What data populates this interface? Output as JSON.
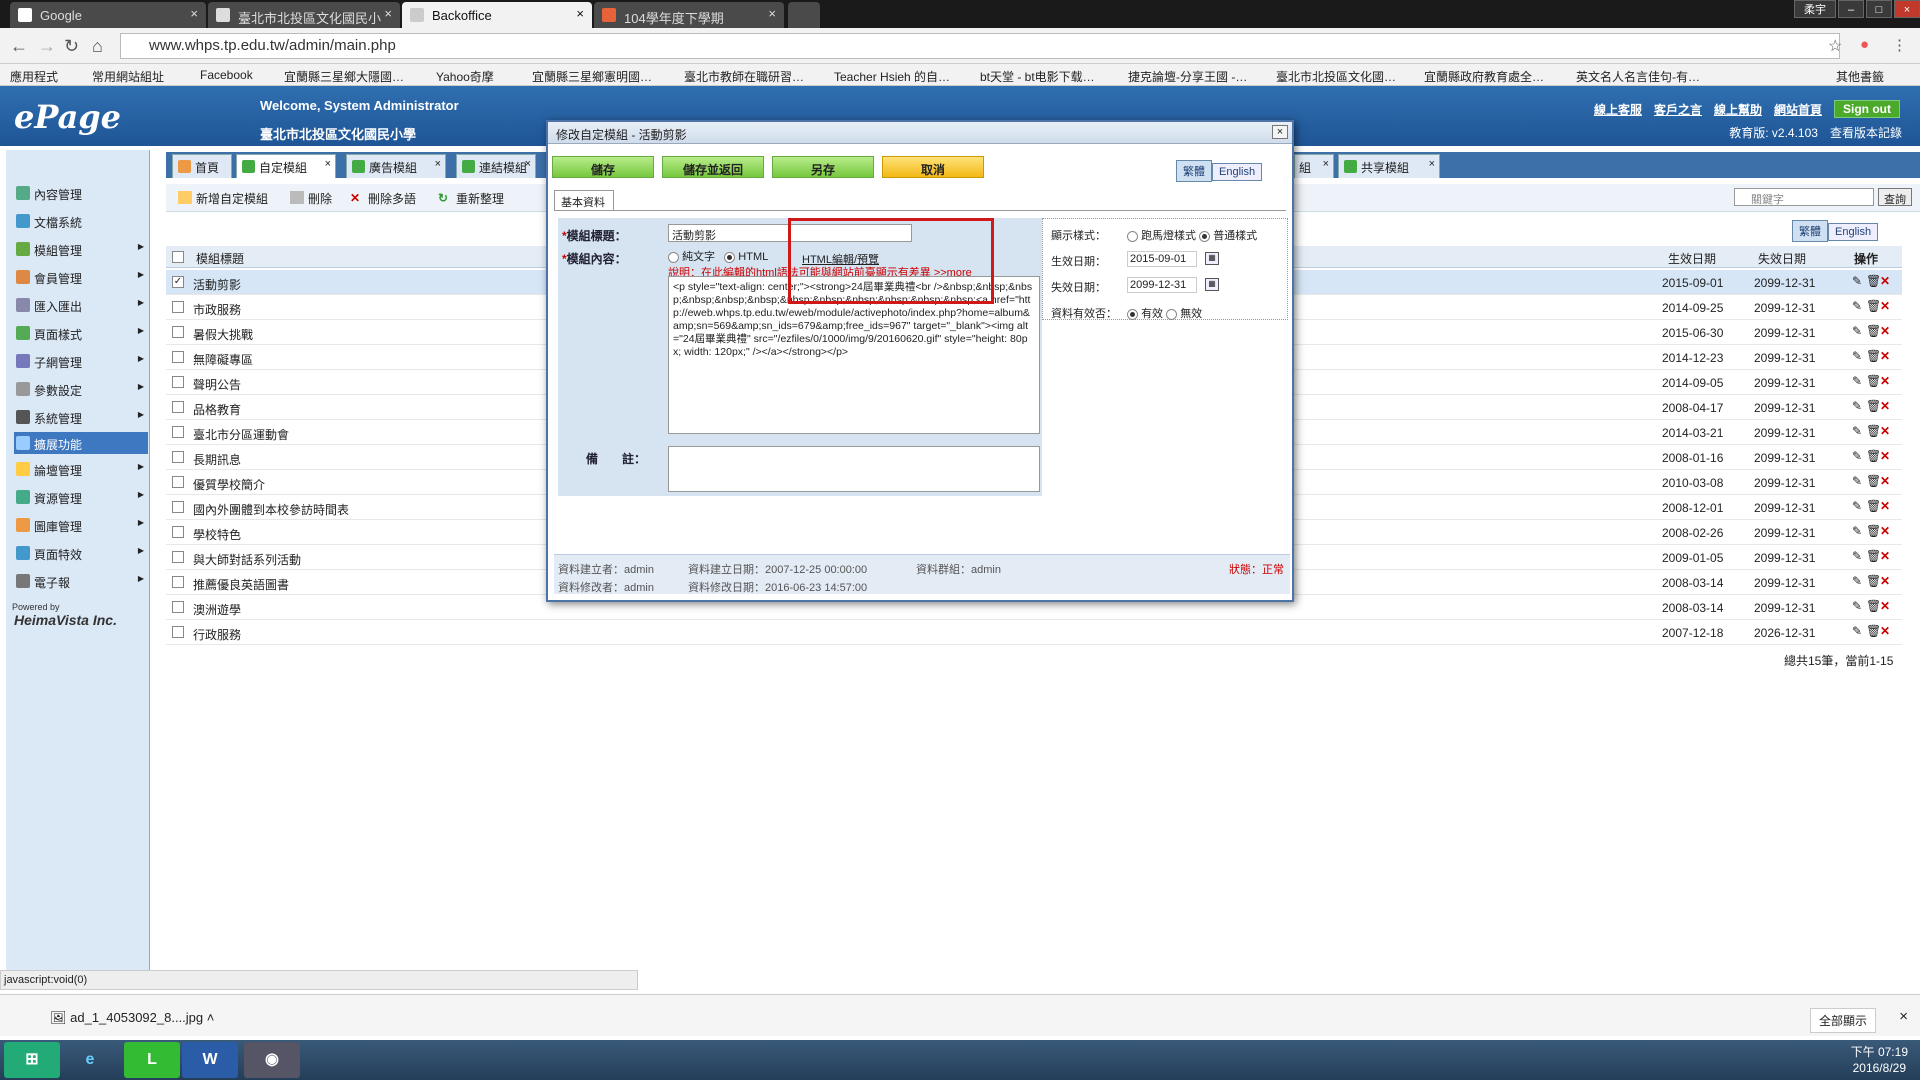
{
  "browser": {
    "tabs": [
      {
        "label": "Google",
        "color": "#ffffff"
      },
      {
        "label": "臺北市北投區文化國民小",
        "color": "#ffffff"
      },
      {
        "label": "Backoffice",
        "color": "#ffffff"
      },
      {
        "label": "104學年度下學期",
        "color": "#e8623a"
      }
    ],
    "user": "柔宇",
    "url": "www.whps.tp.edu.tw/admin/main.php",
    "bookmarks": [
      "應用程式",
      "常用網站組址",
      "Facebook",
      "宜蘭縣三星鄉大隱國…",
      "Yahoo奇摩",
      "宜蘭縣三星鄉憲明國…",
      "臺北市教師在職研習…",
      "Teacher Hsieh 的自…",
      "bt天堂 - bt电影下载…",
      "捷克論壇-分享王國 -…",
      "臺北市北投區文化國…",
      "宜蘭縣政府教育處全…",
      "英文名人名言佳句-有…",
      "其他書籤"
    ]
  },
  "header": {
    "logo": "ePage",
    "welcome": "Welcome, System Administrator",
    "school": "臺北市北投區文化國民小學",
    "links": [
      "線上客服",
      "客戶之言",
      "線上幫助",
      "網站首頁"
    ],
    "signout": "Sign out",
    "version": "教育版: v2.4.103",
    "history": "查看版本記錄"
  },
  "sidebar": {
    "items": [
      {
        "label": "內容管理",
        "arrow": false,
        "selected": false
      },
      {
        "label": "文檔系統",
        "arrow": false,
        "selected": false
      },
      {
        "label": "模組管理",
        "arrow": true,
        "selected": false
      },
      {
        "label": "會員管理",
        "arrow": true,
        "selected": false
      },
      {
        "label": "匯入匯出",
        "arrow": true,
        "selected": false
      },
      {
        "label": "頁面樣式",
        "arrow": true,
        "selected": false
      },
      {
        "label": "子網管理",
        "arrow": true,
        "selected": false
      },
      {
        "label": "參數設定",
        "arrow": true,
        "selected": false
      },
      {
        "label": "系統管理",
        "arrow": true,
        "selected": false
      },
      {
        "label": "擴展功能",
        "arrow": false,
        "selected": true
      },
      {
        "label": "論壇管理",
        "arrow": true,
        "selected": false
      },
      {
        "label": "資源管理",
        "arrow": true,
        "selected": false
      },
      {
        "label": "圖庫管理",
        "arrow": true,
        "selected": false
      },
      {
        "label": "頁面特效",
        "arrow": true,
        "selected": false
      },
      {
        "label": "電子報",
        "arrow": true,
        "selected": false
      }
    ],
    "powered_by": "Powered by",
    "brand": "HeimaVista Inc."
  },
  "main": {
    "tabs": [
      {
        "label": "首頁",
        "closable": false
      },
      {
        "label": "自定模組",
        "closable": true
      },
      {
        "label": "廣告模組",
        "closable": true
      },
      {
        "label": "連結模組",
        "closable": true
      },
      {
        "label": "組",
        "closable": true
      },
      {
        "label": "共享模組",
        "closable": true
      }
    ],
    "toolbar": [
      "新增自定模組",
      "刪除",
      "刪除多語",
      "重新整理"
    ],
    "search_placeholder": "關鍵字",
    "search_button": "查詢",
    "lang_active": "繁體",
    "lang_other": "English",
    "columns": {
      "title": "模組標題",
      "start": "生效日期",
      "end": "失效日期",
      "ops": "操作"
    },
    "rows": [
      {
        "title": "活動剪影",
        "start": "2015-09-01",
        "end": "2099-12-31",
        "checked": true
      },
      {
        "title": "市政服務",
        "start": "2014-09-25",
        "end": "2099-12-31",
        "checked": false
      },
      {
        "title": "暑假大挑戰",
        "start": "2015-06-30",
        "end": "2099-12-31",
        "checked": false
      },
      {
        "title": "無障礙專區",
        "start": "2014-12-23",
        "end": "2099-12-31",
        "checked": false
      },
      {
        "title": "聲明公告",
        "start": "2014-09-05",
        "end": "2099-12-31",
        "checked": false
      },
      {
        "title": "品格教育",
        "start": "2008-04-17",
        "end": "2099-12-31",
        "checked": false
      },
      {
        "title": "臺北市分區運動會",
        "start": "2014-03-21",
        "end": "2099-12-31",
        "checked": false
      },
      {
        "title": "長期訊息",
        "start": "2008-01-16",
        "end": "2099-12-31",
        "checked": false
      },
      {
        "title": "優質學校簡介",
        "start": "2010-03-08",
        "end": "2099-12-31",
        "checked": false
      },
      {
        "title": "國內外團體到本校參訪時間表",
        "start": "2008-12-01",
        "end": "2099-12-31",
        "checked": false
      },
      {
        "title": "學校特色",
        "start": "2008-02-26",
        "end": "2099-12-31",
        "checked": false
      },
      {
        "title": "與大師對話系列活動",
        "start": "2009-01-05",
        "end": "2099-12-31",
        "checked": false
      },
      {
        "title": "推薦優良英語圖書",
        "start": "2008-03-14",
        "end": "2099-12-31",
        "checked": false
      },
      {
        "title": "澳洲遊學",
        "start": "2008-03-14",
        "end": "2099-12-31",
        "checked": false
      },
      {
        "title": "行政服務",
        "start": "2007-12-18",
        "end": "2026-12-31",
        "checked": false
      }
    ],
    "pager": "總共15筆，當前1-15"
  },
  "dialog": {
    "title": "修改自定模組 - 活動剪影",
    "buttons": {
      "save": "儲存",
      "save_return": "儲存並返回",
      "save_as": "另存",
      "cancel": "取消"
    },
    "lang_active": "繁體",
    "lang_other": "English",
    "subtab": "基本資料",
    "label_title": "模組標題：",
    "label_content": "模組內容：",
    "title_value": "活動剪影",
    "content_plain": "純文字",
    "content_html": "HTML",
    "html_edit_link": "HTML編輯/預覽",
    "warning": "說明：在此編輯的html語法可能與網站前臺顯示有差異 >>more",
    "code": "<p style=\"text-align: center;\"><strong>24屆畢業典禮<br />&nbsp;&nbsp;&nbsp;&nbsp;&nbsp;&nbsp;&nbsp;&nbsp;&nbsp;&nbsp;&nbsp;&nbsp;<a href=\"http://eweb.whps.tp.edu.tw/eweb/module/activephoto/index.php?home=album&amp;sn=569&amp;sn_ids=679&amp;free_ids=967\" target=\"_blank\"><img alt=\"24屆畢業典禮\" src=\"/ezfiles/0/1000/img/9/20160620.gif\" style=\"height: 80px; width: 120px;\" /></a></strong></p>",
    "label_remark": "備　　註：",
    "display_label": "顯示樣式：",
    "display_opt1": "跑馬燈樣式",
    "display_opt2": "普通樣式",
    "start_label": "生效日期：",
    "start_value": "2015-09-01",
    "end_label": "失效日期：",
    "end_value": "2099-12-31",
    "valid_label": "資料有效否：",
    "valid_yes": "有效",
    "valid_no": "無效",
    "footer": {
      "creator": "資料建立者：admin",
      "created": "資料建立日期：2007-12-25 00:00:00",
      "group": "資料群組：admin",
      "modifier": "資料修改者：admin",
      "modified": "資料修改日期：2016-06-23 14:57:00",
      "status": "狀態：正常"
    }
  },
  "status_bar": "javascript:void(0)",
  "downloads": {
    "file": "ad_1_4053092_8....jpg",
    "show_all": "全部顯示"
  },
  "taskbar": {
    "time": "下午 07:19",
    "date": "2016/8/29"
  },
  "colors": {
    "header": "#2f6fb0",
    "highlight": "#d01818",
    "save_button": "#76c83e",
    "cancel_button": "#f3b915"
  }
}
